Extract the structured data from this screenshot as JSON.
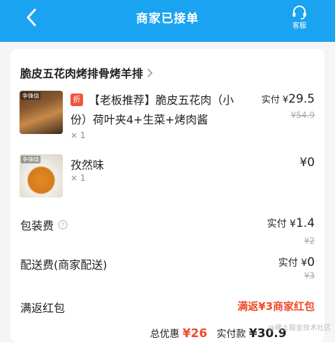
{
  "header": {
    "title": "商家已接单",
    "back_icon": "chevron-left-icon",
    "service_label": "客服",
    "service_icon": "headset-icon",
    "background": "#1aa3f0"
  },
  "shop": {
    "name": "脆皮五花肉烤排骨烤羊排"
  },
  "items": [
    {
      "badge": "折",
      "name": "【老板推荐】脆皮五花肉（小份）荷叶夹4+生菜+烤肉酱",
      "qty": "× 1",
      "actual_label": "实付",
      "actual_currency": "¥",
      "actual_value": "29.5",
      "original_price": "¥54.9",
      "image_tag": "争锋烧"
    },
    {
      "name": "孜然味",
      "qty": "× 1",
      "price": "¥0",
      "image_tag": "争锋烧"
    }
  ],
  "fees": {
    "packaging": {
      "label": "包装费",
      "actual_label": "实付",
      "actual_currency": "¥",
      "actual_value": "1.4",
      "original": "¥2"
    },
    "delivery": {
      "label": "配送费(商家配送)",
      "actual_label": "实付",
      "actual_currency": "¥",
      "actual_value": "0",
      "original": "¥3"
    },
    "red_packet": {
      "label": "满返红包",
      "value": "满返¥3商家红包"
    }
  },
  "summary": {
    "discount_label": "总优惠",
    "discount_value": "¥26",
    "paid_label": "实付款",
    "paid_value": "¥30.9"
  },
  "watermark": "@稀土掘金技术社区",
  "colors": {
    "accent": "#1aa3f0",
    "red": "#f04a2a"
  }
}
